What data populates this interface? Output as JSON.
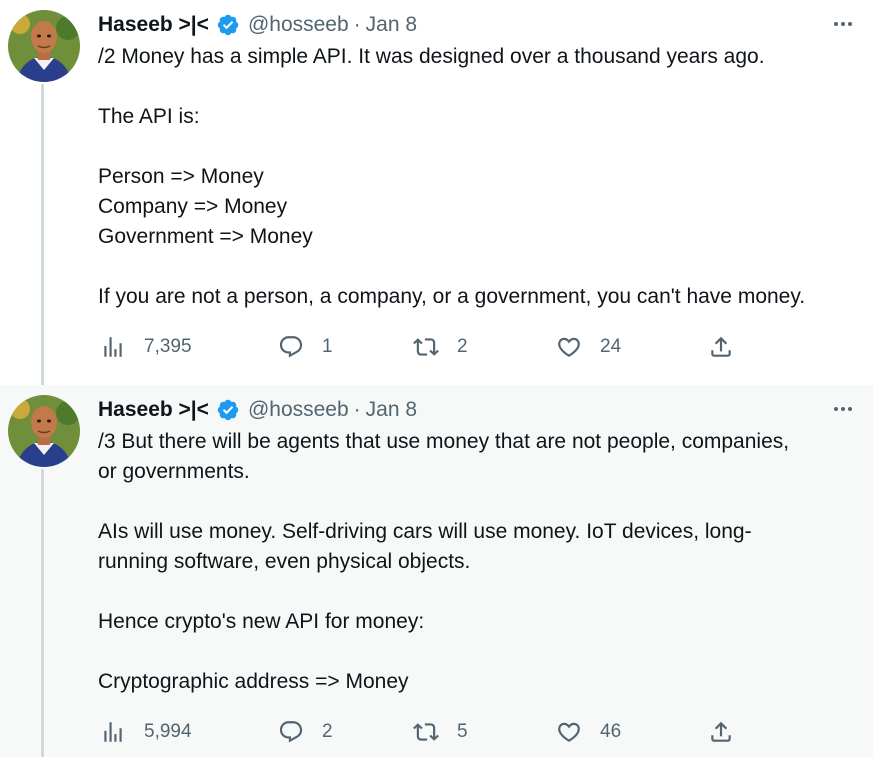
{
  "tweets": [
    {
      "author_name": "Haseeb  >|<",
      "handle": "@hosseeb",
      "separator": "·",
      "date": "Jan 8",
      "lines": [
        "/2 Money has a simple API. It was designed over a thousand years ago.",
        "",
        "The API is:",
        "",
        "Person => Money",
        "Company => Money",
        "Government => Money",
        "",
        "If you are not a person, a company, or a government, you can't have money."
      ],
      "stats": {
        "views": "7,395",
        "replies": "1",
        "retweets": "2",
        "likes": "24"
      }
    },
    {
      "author_name": "Haseeb  >|<",
      "handle": "@hosseeb",
      "separator": "·",
      "date": "Jan 8",
      "lines": [
        "/3 But there will be agents that use money that are not people, companies,",
        "or governments.",
        "",
        "AIs will use money. Self-driving cars will use money. IoT devices, long-",
        "running software, even physical objects.",
        "",
        "Hence crypto's new API for money:",
        "",
        "Cryptographic address => Money"
      ],
      "stats": {
        "views": "5,994",
        "replies": "2",
        "retweets": "5",
        "likes": "46"
      }
    }
  ],
  "icons": {
    "verified": "verified-badge-icon",
    "more": "more-options-icon",
    "views": "views-chart-icon",
    "reply": "reply-bubble-icon",
    "retweet": "retweet-arrows-icon",
    "like": "heart-icon",
    "share": "share-upload-icon"
  },
  "colors": {
    "verified": "#1d9bf0",
    "text": "#0f1419",
    "secondary": "#536471",
    "thread_line": "#cfd9de",
    "highlight_bg": "#f7f9f9"
  }
}
